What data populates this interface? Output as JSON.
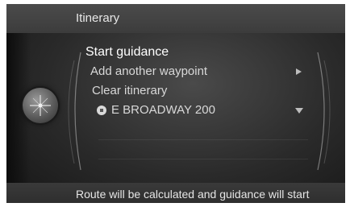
{
  "header": {
    "title": "Itinerary"
  },
  "menu": {
    "items": [
      {
        "label": "Start guidance"
      },
      {
        "label": "Add another waypoint"
      },
      {
        "label": "Clear itinerary"
      },
      {
        "label": "E BROADWAY 200"
      }
    ]
  },
  "footer": {
    "message": "Route will be calculated and guidance will start"
  },
  "colors": {
    "background": "#2a2a2a",
    "text": "#e8e8e8",
    "accent": "#bdbdbd"
  }
}
